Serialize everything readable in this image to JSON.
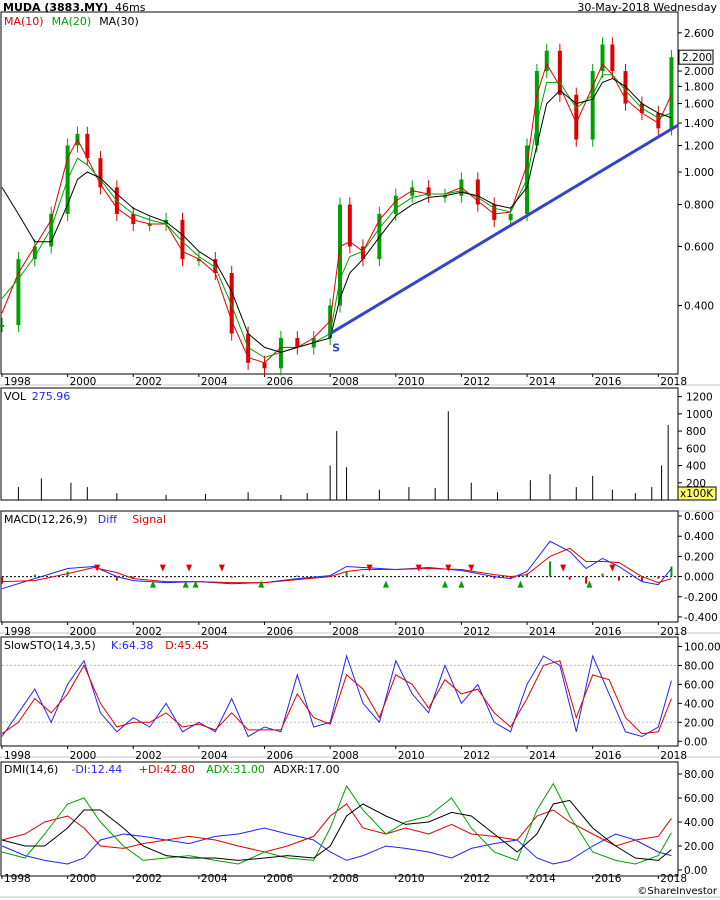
{
  "header": {
    "ticker": "MUDA (3883.MY)",
    "interval": "46ms",
    "date": "30-May-2018 Wednesday",
    "credit": "©ShareInvestor"
  },
  "colors": {
    "up": "#00a000",
    "down": "#e00000",
    "ma10": "#e00000",
    "ma20": "#00a000",
    "ma30": "#000000",
    "trend": "#3344cc",
    "diff": "#2222ff",
    "signal": "#e00000",
    "k": "#2222ff",
    "d": "#e00000",
    "minus_di": "#2222ff",
    "plus_di": "#e00000",
    "adx": "#00a000",
    "adxr": "#000000",
    "vol": "#000000"
  },
  "panels": {
    "price": {
      "legend": [
        {
          "text": "MA(10)",
          "color": "#e00000"
        },
        {
          "text": "MA(20)",
          "color": "#00a000"
        },
        {
          "text": "MA(30)",
          "color": "#000000"
        }
      ],
      "last_price": "2.200",
      "trend_marker": "S"
    },
    "volume": {
      "legend": [
        {
          "text": "VOL",
          "color": "#000000"
        },
        {
          "text": "275.96",
          "color": "#2222ff"
        }
      ],
      "unit": "x100K"
    },
    "macd": {
      "legend": [
        {
          "text": "MACD(12,26,9)",
          "color": "#000000"
        },
        {
          "text": "Diff",
          "color": "#2222ff"
        },
        {
          "text": "Signal",
          "color": "#e00000"
        }
      ]
    },
    "sto": {
      "legend": [
        {
          "text": "SlowSTO(14,3,5)",
          "color": "#000000"
        },
        {
          "text": "K:64.38",
          "color": "#2222ff"
        },
        {
          "text": "D:45.45",
          "color": "#e00000"
        }
      ]
    },
    "dmi": {
      "legend": [
        {
          "text": "DMI(14,6)",
          "color": "#000000"
        },
        {
          "text": "-DI:12.44",
          "color": "#2222ff"
        },
        {
          "text": "+DI:42.80",
          "color": "#e00000"
        },
        {
          "text": "ADX:31.00",
          "color": "#00a000"
        },
        {
          "text": "ADXR:17.00",
          "color": "#000000"
        }
      ]
    }
  },
  "x_axis_labels": [
    "1998",
    "2000",
    "2002",
    "2004",
    "2006",
    "2008",
    "2010",
    "2012",
    "2014",
    "2016",
    "2018"
  ],
  "chart_data": [
    {
      "type": "line",
      "panel": "price",
      "scale": "log",
      "y_ticks": [
        "0.400",
        "0.600",
        "0.800",
        "1.000",
        "1.200",
        "1.400",
        "1.600",
        "1.800",
        "2.000",
        "2.200",
        "2.600"
      ],
      "x": [
        1998.0,
        1998.5,
        1999.0,
        1999.5,
        2000.0,
        2000.3,
        2000.6,
        2001.0,
        2001.5,
        2002.0,
        2002.5,
        2003.0,
        2003.5,
        2004.0,
        2004.5,
        2005.0,
        2005.5,
        2006.0,
        2006.5,
        2007.0,
        2007.5,
        2008.0,
        2008.3,
        2008.6,
        2009.0,
        2009.5,
        2010.0,
        2010.5,
        2011.0,
        2011.5,
        2012.0,
        2012.5,
        2013.0,
        2013.5,
        2014.0,
        2014.3,
        2014.6,
        2015.0,
        2015.5,
        2016.0,
        2016.3,
        2016.6,
        2017.0,
        2017.5,
        2018.0,
        2018.4
      ],
      "series": [
        {
          "values": [
            0.35,
            0.55,
            0.6,
            0.75,
            1.2,
            1.3,
            1.1,
            0.9,
            0.75,
            0.7,
            0.7,
            0.72,
            0.55,
            0.55,
            0.5,
            0.33,
            0.27,
            0.26,
            0.32,
            0.3,
            0.32,
            0.4,
            0.8,
            0.6,
            0.55,
            0.75,
            0.85,
            0.9,
            0.85,
            0.85,
            0.95,
            0.8,
            0.72,
            0.75,
            1.2,
            2.0,
            2.3,
            1.7,
            1.25,
            2.0,
            2.4,
            2.0,
            1.6,
            1.5,
            1.35,
            2.2
          ]
        },
        {
          "name": "MA(10)",
          "values": [
            0.38,
            0.5,
            0.6,
            0.72,
            1.1,
            1.25,
            1.1,
            0.92,
            0.78,
            0.72,
            0.7,
            0.7,
            0.58,
            0.55,
            0.5,
            0.36,
            0.28,
            0.27,
            0.3,
            0.3,
            0.32,
            0.36,
            0.6,
            0.62,
            0.58,
            0.72,
            0.82,
            0.88,
            0.86,
            0.86,
            0.9,
            0.82,
            0.75,
            0.76,
            1.05,
            1.7,
            2.1,
            1.8,
            1.4,
            1.8,
            2.1,
            1.95,
            1.65,
            1.5,
            1.4,
            1.7
          ]
        },
        {
          "name": "MA(20)",
          "values": [
            0.42,
            0.48,
            0.56,
            0.68,
            0.95,
            1.1,
            1.05,
            0.95,
            0.82,
            0.75,
            0.72,
            0.7,
            0.62,
            0.56,
            0.52,
            0.4,
            0.3,
            0.28,
            0.29,
            0.3,
            0.31,
            0.33,
            0.48,
            0.56,
            0.58,
            0.68,
            0.78,
            0.84,
            0.86,
            0.86,
            0.88,
            0.84,
            0.78,
            0.76,
            0.95,
            1.4,
            1.85,
            1.85,
            1.55,
            1.7,
            1.95,
            1.95,
            1.75,
            1.55,
            1.45,
            1.5
          ]
        },
        {
          "name": "MA(30)",
          "values": [
            0.9,
            0.75,
            0.62,
            0.62,
            0.8,
            0.95,
            1.0,
            0.96,
            0.86,
            0.78,
            0.74,
            0.71,
            0.65,
            0.58,
            0.54,
            0.44,
            0.33,
            0.3,
            0.29,
            0.3,
            0.31,
            0.32,
            0.42,
            0.5,
            0.55,
            0.64,
            0.74,
            0.8,
            0.84,
            0.85,
            0.87,
            0.85,
            0.8,
            0.78,
            0.9,
            1.2,
            1.6,
            1.75,
            1.6,
            1.65,
            1.85,
            1.9,
            1.8,
            1.6,
            1.5,
            1.45
          ]
        }
      ],
      "trendline": {
        "from": [
          2008.0,
          0.33
        ],
        "to": [
          2018.6,
          1.38
        ]
      }
    },
    {
      "type": "bar",
      "panel": "volume",
      "y_ticks": [
        "200",
        "400",
        "600",
        "800",
        "1000",
        "1200"
      ],
      "ylim": [
        0,
        1300
      ],
      "x": [
        1998.5,
        1999.2,
        2000.1,
        2000.6,
        2001.5,
        2003.0,
        2004.2,
        2005.5,
        2006.5,
        2007.3,
        2008.0,
        2008.2,
        2008.5,
        2009.5,
        2010.4,
        2011.2,
        2011.6,
        2012.3,
        2013.1,
        2014.1,
        2014.7,
        2015.5,
        2016.0,
        2016.6,
        2017.3,
        2017.8,
        2018.1,
        2018.3
      ],
      "values": [
        150,
        250,
        200,
        150,
        80,
        60,
        70,
        90,
        60,
        80,
        400,
        800,
        380,
        120,
        150,
        140,
        1030,
        200,
        90,
        230,
        300,
        150,
        280,
        120,
        80,
        150,
        400,
        870
      ]
    },
    {
      "type": "line",
      "panel": "macd",
      "y_ticks": [
        "-0.400",
        "-0.200",
        "0.000",
        "0.200",
        "0.400",
        "0.600"
      ],
      "ylim": [
        -0.45,
        0.65
      ],
      "x": [
        1998.0,
        1999.0,
        2000.0,
        2000.8,
        2001.5,
        2002.0,
        2003.0,
        2004.0,
        2005.0,
        2006.0,
        2007.0,
        2008.0,
        2008.5,
        2009.0,
        2010.0,
        2011.0,
        2012.0,
        2013.0,
        2013.5,
        2014.0,
        2014.7,
        2015.3,
        2015.8,
        2016.3,
        2016.8,
        2017.5,
        2018.0,
        2018.4
      ],
      "series": [
        {
          "name": "Diff",
          "values": [
            -0.12,
            -0.02,
            0.08,
            0.1,
            0.0,
            -0.04,
            -0.06,
            -0.05,
            -0.07,
            -0.06,
            -0.02,
            0.01,
            0.1,
            0.09,
            0.07,
            0.09,
            0.06,
            0.0,
            -0.02,
            0.05,
            0.35,
            0.25,
            0.08,
            0.18,
            0.1,
            -0.05,
            -0.08,
            0.08
          ]
        },
        {
          "name": "Signal",
          "values": [
            -0.05,
            -0.04,
            0.03,
            0.09,
            0.04,
            -0.02,
            -0.05,
            -0.05,
            -0.06,
            -0.06,
            -0.03,
            0.0,
            0.05,
            0.07,
            0.07,
            0.08,
            0.07,
            0.02,
            0.0,
            0.02,
            0.2,
            0.28,
            0.15,
            0.15,
            0.14,
            0.0,
            -0.06,
            -0.02
          ]
        }
      ],
      "signals": [
        {
          "x": 2000.9,
          "dir": "down"
        },
        {
          "x": 2002.9,
          "dir": "down"
        },
        {
          "x": 2003.7,
          "dir": "down"
        },
        {
          "x": 2004.7,
          "dir": "down"
        },
        {
          "x": 2002.6,
          "dir": "up"
        },
        {
          "x": 2003.6,
          "dir": "up"
        },
        {
          "x": 2003.9,
          "dir": "up"
        },
        {
          "x": 2005.9,
          "dir": "up"
        },
        {
          "x": 2009.2,
          "dir": "down"
        },
        {
          "x": 2010.7,
          "dir": "down"
        },
        {
          "x": 2011.6,
          "dir": "down"
        },
        {
          "x": 2012.3,
          "dir": "down"
        },
        {
          "x": 2009.7,
          "dir": "up"
        },
        {
          "x": 2011.5,
          "dir": "up"
        },
        {
          "x": 2012.0,
          "dir": "up"
        },
        {
          "x": 2013.8,
          "dir": "up"
        },
        {
          "x": 2015.1,
          "dir": "down"
        },
        {
          "x": 2016.6,
          "dir": "down"
        },
        {
          "x": 2015.9,
          "dir": "up"
        }
      ]
    },
    {
      "type": "line",
      "panel": "sto",
      "y_ticks": [
        "0.00",
        "20.00",
        "40.00",
        "60.00",
        "80.00",
        "100.00"
      ],
      "ylim": [
        -5,
        110
      ],
      "x": [
        1998.0,
        1998.5,
        1999.0,
        1999.5,
        2000.0,
        2000.5,
        2001.0,
        2001.5,
        2002.0,
        2002.5,
        2003.0,
        2003.5,
        2004.0,
        2004.5,
        2005.0,
        2005.5,
        2006.0,
        2006.5,
        2007.0,
        2007.5,
        2008.0,
        2008.5,
        2009.0,
        2009.5,
        2010.0,
        2010.5,
        2011.0,
        2011.5,
        2012.0,
        2012.5,
        2013.0,
        2013.5,
        2014.0,
        2014.5,
        2015.0,
        2015.5,
        2016.0,
        2016.5,
        2017.0,
        2017.5,
        2018.0,
        2018.4
      ],
      "series": [
        {
          "name": "K",
          "values": [
            5,
            30,
            55,
            20,
            60,
            85,
            30,
            10,
            25,
            15,
            40,
            10,
            20,
            10,
            45,
            5,
            15,
            10,
            70,
            15,
            20,
            90,
            40,
            20,
            85,
            50,
            30,
            80,
            40,
            60,
            20,
            10,
            60,
            90,
            80,
            10,
            90,
            50,
            10,
            5,
            15,
            64
          ]
        },
        {
          "name": "D",
          "values": [
            8,
            20,
            45,
            30,
            50,
            80,
            40,
            15,
            20,
            20,
            30,
            15,
            18,
            12,
            30,
            12,
            12,
            12,
            50,
            25,
            18,
            70,
            55,
            25,
            70,
            60,
            35,
            65,
            50,
            55,
            30,
            15,
            45,
            80,
            85,
            25,
            70,
            65,
            25,
            8,
            10,
            45
          ]
        }
      ]
    },
    {
      "type": "line",
      "panel": "dmi",
      "y_ticks": [
        "0.00",
        "20.00",
        "40.00",
        "60.00",
        "80.00"
      ],
      "ylim": [
        -5,
        90
      ],
      "x": [
        1998.0,
        1998.7,
        1999.3,
        2000.0,
        2000.5,
        2001.0,
        2001.7,
        2002.3,
        2003.0,
        2003.7,
        2004.5,
        2005.2,
        2006.0,
        2006.7,
        2007.5,
        2008.0,
        2008.5,
        2009.0,
        2009.7,
        2010.3,
        2011.0,
        2011.7,
        2012.3,
        2013.0,
        2013.7,
        2014.3,
        2014.8,
        2015.3,
        2016.0,
        2016.7,
        2017.3,
        2018.0,
        2018.4
      ],
      "series": [
        {
          "name": "-DI",
          "values": [
            20,
            12,
            8,
            5,
            10,
            25,
            30,
            28,
            25,
            22,
            28,
            30,
            35,
            30,
            25,
            15,
            8,
            12,
            20,
            18,
            15,
            10,
            18,
            22,
            25,
            10,
            5,
            8,
            20,
            30,
            25,
            15,
            12
          ]
        },
        {
          "name": "+DI",
          "values": [
            25,
            30,
            40,
            45,
            35,
            20,
            18,
            22,
            25,
            28,
            25,
            20,
            15,
            20,
            28,
            45,
            55,
            35,
            30,
            35,
            30,
            38,
            30,
            28,
            25,
            45,
            50,
            40,
            30,
            20,
            25,
            28,
            43
          ]
        },
        {
          "name": "ADX",
          "values": [
            15,
            10,
            30,
            55,
            60,
            40,
            20,
            8,
            10,
            12,
            8,
            5,
            15,
            10,
            8,
            35,
            70,
            50,
            30,
            40,
            45,
            60,
            35,
            15,
            8,
            50,
            72,
            45,
            15,
            8,
            5,
            12,
            31
          ]
        },
        {
          "name": "ADXR",
          "values": [
            25,
            20,
            20,
            35,
            50,
            50,
            35,
            20,
            12,
            10,
            10,
            8,
            10,
            12,
            10,
            20,
            45,
            55,
            45,
            38,
            40,
            48,
            45,
            30,
            15,
            30,
            55,
            58,
            35,
            20,
            10,
            8,
            17
          ]
        }
      ]
    }
  ]
}
